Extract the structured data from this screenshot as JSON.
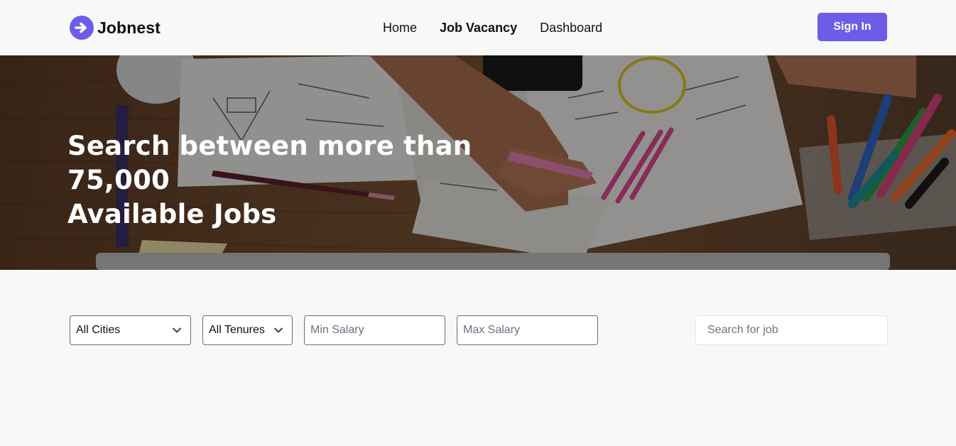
{
  "brand": {
    "name": "Jobnest",
    "icon": "arrow-right-circle-icon",
    "color": "#6c5ce7"
  },
  "nav": {
    "links": [
      {
        "label": "Home",
        "active": false
      },
      {
        "label": "Job Vacancy",
        "active": true
      },
      {
        "label": "Dashboard",
        "active": false
      }
    ],
    "signin_label": "Sign In"
  },
  "hero": {
    "title_line1": "Search between more than 75,000",
    "title_line2": "Available Jobs"
  },
  "filters": {
    "city": {
      "value": "All Cities"
    },
    "tenure": {
      "value": "All Tenures"
    },
    "min_salary": {
      "placeholder": "Min Salary"
    },
    "max_salary": {
      "placeholder": "Max Salary"
    },
    "search": {
      "placeholder": "Search for job"
    }
  },
  "colors": {
    "accent": "#6c5ce7",
    "background": "#f8f8f8"
  }
}
